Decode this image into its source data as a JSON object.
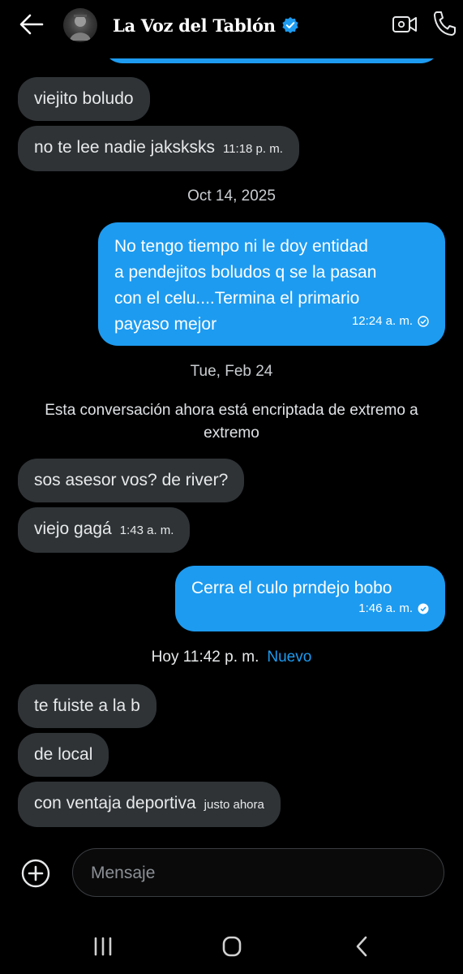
{
  "header": {
    "title": "La Voz del Tablón",
    "back_icon": "arrow-left-icon",
    "verified_icon": "verified-badge-icon",
    "video_icon": "video-call-icon",
    "phone_icon": "phone-icon"
  },
  "messages": {
    "m1": {
      "text": "viejito boludo"
    },
    "m2": {
      "text": "no te lee nadie jaksksks",
      "time": "11:18 p. m."
    },
    "sep1": "Oct 14, 2025",
    "m3": {
      "lines": [
        "No tengo tiempo ni le doy entidad",
        "a pendejitos boludos q se la pasan",
        "con el celu....Termina el primario",
        "payaso mejor"
      ],
      "time": "12:24 a. m."
    },
    "sep2": "Tue, Feb 24",
    "encryption": "Esta conversación ahora está encriptada de extremo a extremo",
    "m4": {
      "text": "sos asesor vos? de river?"
    },
    "m5": {
      "text": "viejo gagá",
      "time": "1:43 a. m."
    },
    "m6": {
      "text": "Cerra el culo prndejo bobo",
      "time": "1:46 a. m."
    },
    "sep3": {
      "label": "Hoy 11:42 p. m.",
      "new_label": "Nuevo"
    },
    "m7": {
      "text": "te fuiste a la b"
    },
    "m8": {
      "text": "de local"
    },
    "m9": {
      "text": "con ventaja deportiva",
      "time": "justo ahora"
    }
  },
  "composer": {
    "placeholder": "Mensaje",
    "add_icon": "plus-circle-icon"
  },
  "system_nav": {
    "recents_icon": "recents-icon",
    "home_icon": "home-icon",
    "back_icon": "back-chevron-icon"
  },
  "colors": {
    "accent": "#1d9bf0",
    "incoming_bubble": "#2f3336",
    "background": "#000000"
  }
}
